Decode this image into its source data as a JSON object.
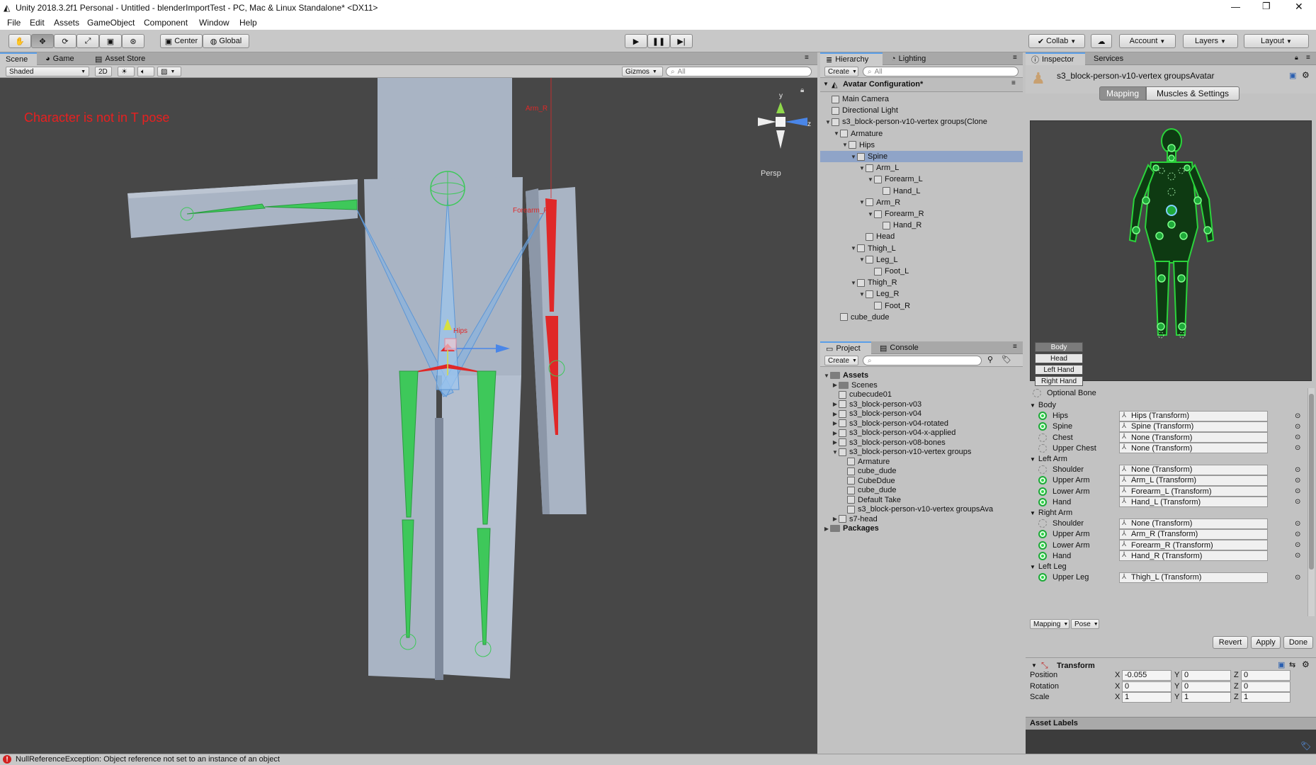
{
  "window": {
    "title": "Unity 2018.3.2f1 Personal - Untitled - blenderImportTest - PC, Mac & Linux Standalone* <DX11>"
  },
  "menu": [
    "File",
    "Edit",
    "Assets",
    "GameObject",
    "Component",
    "Window",
    "Help"
  ],
  "toolbar": {
    "center_label": "Center",
    "global_label": "Global",
    "collab_label": "Collab",
    "account_label": "Account",
    "layers_label": "Layers",
    "layout_label": "Layout"
  },
  "scene_panel": {
    "tabs": [
      "Scene",
      "Game",
      "Asset Store"
    ],
    "shading_mode": "Shaded",
    "mode_2d": "2D",
    "gizmos_label": "Gizmos",
    "search_placeholder": "All",
    "warning_text": "Character is not in T pose",
    "persp_label": "Persp",
    "gizmo_axes": {
      "y": "y",
      "z": "z"
    },
    "bone_labels": {
      "hips": "Hips",
      "forearm": "Forearm_R",
      "arm": "Arm_R"
    },
    "colors": {
      "background": "#474747",
      "mesh": "#a9b4c4",
      "bone_ok": "#3ec85a",
      "bone_bad": "#e02828",
      "bone_sel": "#7fb2e8",
      "warning": "#e82020"
    }
  },
  "hierarchy": {
    "tabs": [
      "Hierarchy",
      "Lighting"
    ],
    "create_label": "Create",
    "search_placeholder": "All",
    "root": "Avatar Configuration*",
    "items": [
      {
        "label": "Main Camera",
        "depth": 1,
        "arrow": ""
      },
      {
        "label": "Directional Light",
        "depth": 1,
        "arrow": ""
      },
      {
        "label": "s3_block-person-v10-vertex groups(Clone",
        "depth": 1,
        "arrow": "▼"
      },
      {
        "label": "Armature",
        "depth": 2,
        "arrow": "▼"
      },
      {
        "label": "Hips",
        "depth": 3,
        "arrow": "▼"
      },
      {
        "label": "Spine",
        "depth": 4,
        "arrow": "▼",
        "selected": true
      },
      {
        "label": "Arm_L",
        "depth": 5,
        "arrow": "▼"
      },
      {
        "label": "Forearm_L",
        "depth": 6,
        "arrow": "▼"
      },
      {
        "label": "Hand_L",
        "depth": 7,
        "arrow": ""
      },
      {
        "label": "Arm_R",
        "depth": 5,
        "arrow": "▼"
      },
      {
        "label": "Forearm_R",
        "depth": 6,
        "arrow": "▼"
      },
      {
        "label": "Hand_R",
        "depth": 7,
        "arrow": ""
      },
      {
        "label": "Head",
        "depth": 5,
        "arrow": ""
      },
      {
        "label": "Thigh_L",
        "depth": 4,
        "arrow": "▼"
      },
      {
        "label": "Leg_L",
        "depth": 5,
        "arrow": "▼"
      },
      {
        "label": "Foot_L",
        "depth": 6,
        "arrow": ""
      },
      {
        "label": "Thigh_R",
        "depth": 4,
        "arrow": "▼"
      },
      {
        "label": "Leg_R",
        "depth": 5,
        "arrow": "▼"
      },
      {
        "label": "Foot_R",
        "depth": 6,
        "arrow": ""
      },
      {
        "label": "cube_dude",
        "depth": 2,
        "arrow": ""
      }
    ]
  },
  "project": {
    "tabs": [
      "Project",
      "Console"
    ],
    "create_label": "Create",
    "items": [
      {
        "label": "Assets",
        "depth": 0,
        "arrow": "▼",
        "folder": true,
        "bold": true
      },
      {
        "label": "Scenes",
        "depth": 1,
        "arrow": "▶",
        "folder": true
      },
      {
        "label": "cubecude01",
        "depth": 1,
        "arrow": ""
      },
      {
        "label": "s3_block-person-v03",
        "depth": 1,
        "arrow": "▶"
      },
      {
        "label": "s3_block-person-v04",
        "depth": 1,
        "arrow": "▶"
      },
      {
        "label": "s3_block-person-v04-rotated",
        "depth": 1,
        "arrow": "▶"
      },
      {
        "label": "s3_block-person-v04-x-applied",
        "depth": 1,
        "arrow": "▶"
      },
      {
        "label": "s3_block-person-v08-bones",
        "depth": 1,
        "arrow": "▶"
      },
      {
        "label": "s3_block-person-v10-vertex groups",
        "depth": 1,
        "arrow": "▼"
      },
      {
        "label": "Armature",
        "depth": 2,
        "arrow": ""
      },
      {
        "label": "cube_dude",
        "depth": 2,
        "arrow": ""
      },
      {
        "label": "CubeDdue",
        "depth": 2,
        "arrow": ""
      },
      {
        "label": "cube_dude",
        "depth": 2,
        "arrow": ""
      },
      {
        "label": "Default Take",
        "depth": 2,
        "arrow": ""
      },
      {
        "label": "s3_block-person-v10-vertex groupsAva",
        "depth": 2,
        "arrow": ""
      },
      {
        "label": "s7-head",
        "depth": 1,
        "arrow": "▶"
      },
      {
        "label": "Packages",
        "depth": 0,
        "arrow": "▶",
        "folder": true,
        "bold": true
      }
    ]
  },
  "inspector": {
    "tabs": [
      "Inspector",
      "Services"
    ],
    "object_name": "s3_block-person-v10-vertex groupsAvatar",
    "mode_tabs": [
      "Mapping",
      "Muscles & Settings"
    ],
    "body_parts": [
      "Body",
      "Head",
      "Left Hand",
      "Right Hand"
    ],
    "optional_bone_label": "Optional Bone",
    "groups": [
      {
        "name": "Body",
        "bones": [
          {
            "name": "Hips",
            "value": "Hips (Transform)",
            "mapped": true
          },
          {
            "name": "Spine",
            "value": "Spine (Transform)",
            "mapped": true
          },
          {
            "name": "Chest",
            "value": "None (Transform)",
            "mapped": false
          },
          {
            "name": "Upper Chest",
            "value": "None (Transform)",
            "mapped": false
          }
        ]
      },
      {
        "name": "Left Arm",
        "bones": [
          {
            "name": "Shoulder",
            "value": "None (Transform)",
            "mapped": false
          },
          {
            "name": "Upper Arm",
            "value": "Arm_L (Transform)",
            "mapped": true
          },
          {
            "name": "Lower Arm",
            "value": "Forearm_L (Transform)",
            "mapped": true
          },
          {
            "name": "Hand",
            "value": "Hand_L (Transform)",
            "mapped": true
          }
        ]
      },
      {
        "name": "Right Arm",
        "bones": [
          {
            "name": "Shoulder",
            "value": "None (Transform)",
            "mapped": false
          },
          {
            "name": "Upper Arm",
            "value": "Arm_R (Transform)",
            "mapped": true
          },
          {
            "name": "Lower Arm",
            "value": "Forearm_R (Transform)",
            "mapped": true
          },
          {
            "name": "Hand",
            "value": "Hand_R (Transform)",
            "mapped": true
          }
        ]
      },
      {
        "name": "Left Leg",
        "bones": [
          {
            "name": "Upper Leg",
            "value": "Thigh_L (Transform)",
            "mapped": true
          }
        ]
      }
    ],
    "footer_menus": [
      "Mapping",
      "Pose"
    ],
    "buttons": {
      "revert": "Revert",
      "apply": "Apply",
      "done": "Done"
    },
    "transform": {
      "title": "Transform",
      "rows": [
        {
          "label": "Position",
          "x": "-0.055",
          "y": "0",
          "z": "0"
        },
        {
          "label": "Rotation",
          "x": "0",
          "y": "0",
          "z": "0"
        },
        {
          "label": "Scale",
          "x": "1",
          "y": "1",
          "z": "1"
        }
      ],
      "axis_labels": {
        "x": "X",
        "y": "Y",
        "z": "Z"
      }
    },
    "asset_labels_title": "Asset Labels"
  },
  "status": {
    "message": "NullReferenceException: Object reference not set to an instance of an object"
  }
}
